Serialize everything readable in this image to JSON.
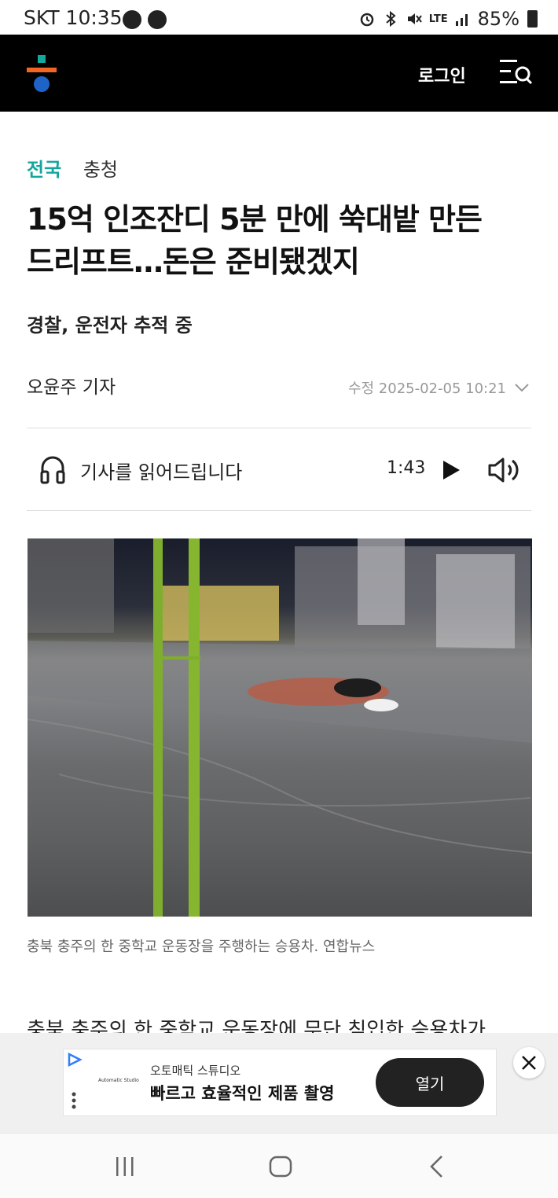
{
  "status_bar": {
    "carrier_time": "SKT 10:35",
    "network": "LTE",
    "battery": "85%"
  },
  "header": {
    "login_label": "로그인",
    "menu_icon": "menu-search-icon"
  },
  "article": {
    "section": "전국",
    "subsection": "충청",
    "title_line1": "15억 인조잔디 5분 만에 쑥대밭 만든",
    "title_line2": "드리프트…돈은 준비됐겠지",
    "subtitle": "경찰, 운전자 추적 중",
    "byline": "오윤주 기자",
    "modified": "수정 2025-02-05 10:21"
  },
  "audio": {
    "label": "기사를 읽어드립니다",
    "duration": "1:43"
  },
  "photo": {
    "caption": "충북 충주의 한 중학교 운동장을 주행하는 승용차. 연합뉴스"
  },
  "body": {
    "first_line": "충북 충주의 한 중학교 운동장에 무단 침입한 승용차가"
  },
  "ad": {
    "advertiser": "오토매틱 스튜디오",
    "headline": "빠르고 효율적인 제품 촬영",
    "cta": "열기",
    "logo_text": "Automatic Studio"
  },
  "colors": {
    "header_bg": "#000000",
    "section_accent": "#14a69e",
    "logo_orange": "#f26522",
    "logo_teal": "#12a89d",
    "logo_blue": "#1e64c8"
  }
}
